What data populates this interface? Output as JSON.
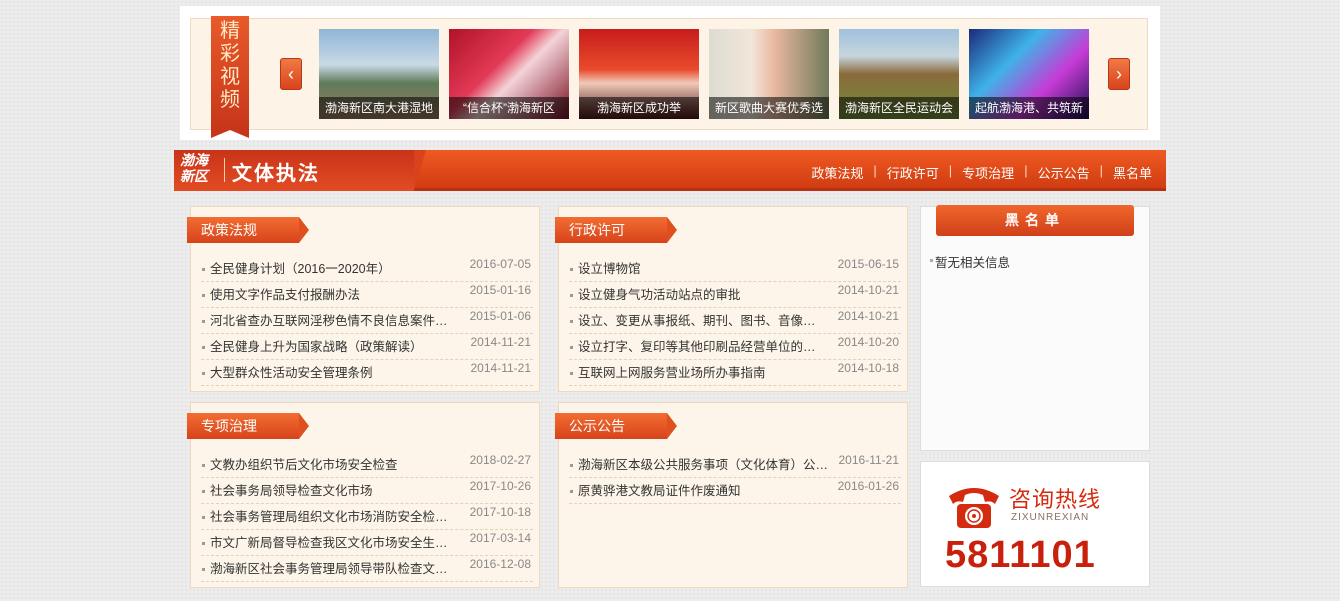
{
  "video": {
    "label": "精彩视频",
    "prev_label": "‹",
    "next_label": "›",
    "items": [
      {
        "caption": "渤海新区南大港湿地"
      },
      {
        "caption": "“信合杯”渤海新区"
      },
      {
        "caption": "渤海新区成功举"
      },
      {
        "caption": "新区歌曲大赛优秀选"
      },
      {
        "caption": "渤海新区全民运动会"
      },
      {
        "caption": "起航渤海港、共筑新"
      }
    ]
  },
  "header": {
    "logo_text": "渤海新区",
    "title": "文体执法",
    "nav": [
      "政策法规",
      "行政许可",
      "专项治理",
      "公示公告",
      "黑名单"
    ]
  },
  "panels": [
    {
      "title": "政策法规",
      "items": [
        {
          "title": "全民健身计划（2016一2020年）",
          "date": "2016-07-05"
        },
        {
          "title": "使用文字作品支付报酬办法",
          "date": "2015-01-16"
        },
        {
          "title": "河北省查办互联网淫秽色情不良信息案件…",
          "date": "2015-01-06"
        },
        {
          "title": "全民健身上升为国家战略（政策解读）",
          "date": "2014-11-21"
        },
        {
          "title": "大型群众性活动安全管理条例",
          "date": "2014-11-21"
        }
      ]
    },
    {
      "title": "行政许可",
      "items": [
        {
          "title": "设立博物馆",
          "date": "2015-06-15"
        },
        {
          "title": "设立健身气功活动站点的审批",
          "date": "2014-10-21"
        },
        {
          "title": "设立、变更从事报纸、期刊、图书、音像…",
          "date": "2014-10-21"
        },
        {
          "title": "设立打字、复印等其他印刷品经营单位的…",
          "date": "2014-10-20"
        },
        {
          "title": "互联网上网服务营业场所办事指南",
          "date": "2014-10-18"
        }
      ]
    },
    {
      "title": "专项治理",
      "items": [
        {
          "title": "文教办组织节后文化市场安全检查",
          "date": "2018-02-27"
        },
        {
          "title": "社会事务局领导检查文化市场",
          "date": "2017-10-26"
        },
        {
          "title": "社会事务管理局组织文化市场消防安全检…",
          "date": "2017-10-18"
        },
        {
          "title": "市文广新局督导检查我区文化市场安全生…",
          "date": "2017-03-14"
        },
        {
          "title": "渤海新区社会事务管理局领导带队检查文…",
          "date": "2016-12-08"
        }
      ]
    },
    {
      "title": "公示公告",
      "items": [
        {
          "title": "渤海新区本级公共服务事项（文化体育）公…",
          "date": "2016-11-21"
        },
        {
          "title": "原黄骅港文教局证件作废通知",
          "date": "2016-01-26"
        }
      ]
    }
  ],
  "blacklist": {
    "title": "黑名单",
    "empty": "暂无相关信息"
  },
  "hotline": {
    "title": "咨询热线",
    "subtitle": "ZIXUNREXIAN",
    "number": "5811101"
  },
  "colors": {
    "accent": "#e04a1c",
    "panel_bg": "#fdf5e9",
    "hotline_red": "#c8200c"
  }
}
